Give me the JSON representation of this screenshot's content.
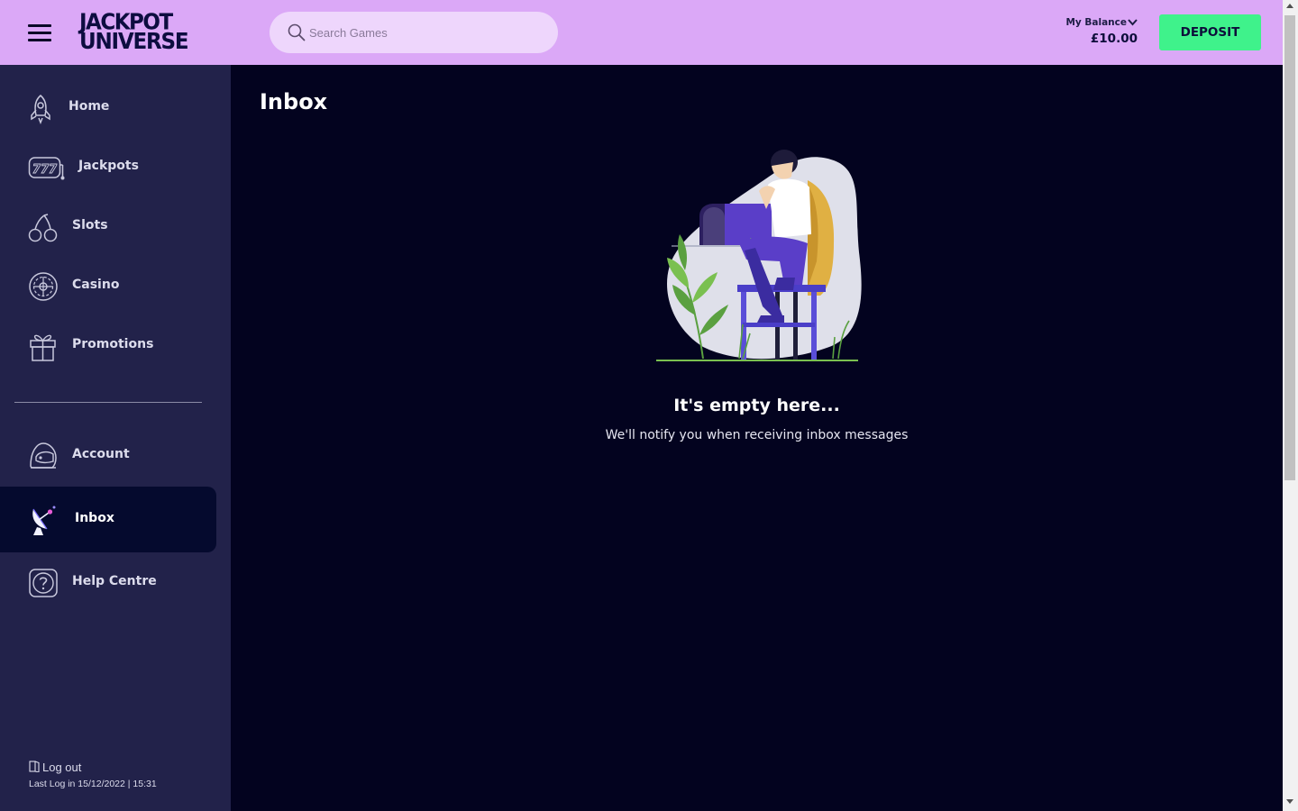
{
  "header": {
    "logo_line1": "JACKPOT",
    "logo_line2": "UNIVERSE",
    "search_placeholder": "Search Games",
    "balance_label": "My Balance",
    "balance_amount": "£10.00",
    "deposit_label": "DEPOSIT"
  },
  "sidebar": {
    "items": [
      {
        "label": "Home",
        "icon": "rocket-icon"
      },
      {
        "label": "Jackpots",
        "icon": "slot-777-icon"
      },
      {
        "label": "Slots",
        "icon": "cherries-icon"
      },
      {
        "label": "Casino",
        "icon": "roulette-icon"
      },
      {
        "label": "Promotions",
        "icon": "gift-icon"
      },
      {
        "label": "Account",
        "icon": "astronaut-helmet-icon"
      },
      {
        "label": "Inbox",
        "icon": "satellite-dish-icon",
        "active": true
      },
      {
        "label": "Help Centre",
        "icon": "help-question-icon"
      }
    ],
    "logout_label": "Log out",
    "last_login": "Last Log in 15/12/2022 | 15:31"
  },
  "main": {
    "title": "Inbox",
    "empty_title": "It's empty here...",
    "empty_subtitle": "We'll notify you when receiving inbox messages"
  },
  "colors": {
    "header_bg": "#dba8f7",
    "sidebar_bg": "#22224a",
    "main_bg": "#03031f",
    "deposit_bg": "#3ff28b",
    "active_item_bg": "#050a2e"
  }
}
